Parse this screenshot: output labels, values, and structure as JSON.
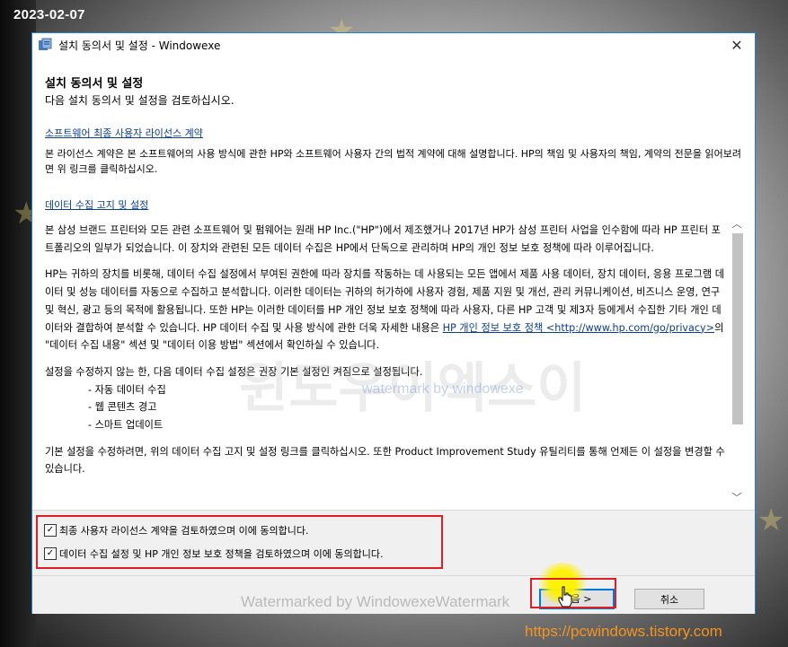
{
  "datestamp": "2023-02-07",
  "window": {
    "title": "설치 동의서 및 설정   - Windowexe",
    "close_glyph": "✕"
  },
  "content": {
    "heading": "설치 동의서 및 설정",
    "subheading": "다음 설치 동의서 및 설정을 검토하십시오.",
    "eula_link": "소프트웨어 최종 사용자 라이선스 계약",
    "eula_desc": "본 라이선스 계약은 본 소프트웨어의 사용 방식에 관한 HP와 소프트웨어 사용자 간의 법적 계약에 대해 설명합니다. HP의 책임 및 사용자의 책임, 계약의 전문을 읽어보려면 위 링크를 클릭하십시오.",
    "dc_link": "데이터 수집 고지 및 설정",
    "scroll_text": {
      "p1": "본 삼성 브랜드 프린터와 모든 관련 소프트웨어 및 펌웨어는 원래 HP Inc.(\"HP\")에서 제조했거나 2017년 HP가 삼성 프린터 사업을 인수함에 따라 HP 프린터 포트폴리오의 일부가 되었습니다. 이 장치와 관련된 모든 데이터 수집은 HP에서 단독으로 관리하며 HP의 개인 정보 보호 정책에 따라 이루어집니다.",
      "p2_before": "HP는 귀하의 장치를 비롯해, 데이터 수집 설정에서 부여된 권한에 따라 장치를 작동하는 데 사용되는 모든 앱에서 제품 사용 데이터, 장치 데이터, 응용 프로그램 데이터 및 성능 데이터를 자동으로 수집하고 분석합니다. 이러한 데이터는 귀하의 허가하에 사용자 경험, 제품 지원 및 개선, 관리 커뮤니케이션, 비즈니스 운영, 연구 및 혁신, 광고 등의 목적에 활용됩니다. 또한 HP는 이러한 데이터를 HP 개인 정보 보호 정책에 따라 사용자, 다른 HP 고객 및 제3자 등에게서 수집한 기타 개인 데이터와 결합하여 분석할 수 있습니다. HP 데이터 수집 및 사용 방식에 관한 더욱 자세한 내용은 ",
      "p2_link": "HP 개인 정보 보호 정책 <http://www.hp.com/go/privacy>",
      "p2_after": "의 \"데이터 수집 내용\" 섹션 및 \"데이터 이용 방법\" 섹션에서 확인하실 수 있습니다.",
      "p3": "설정을 수정하지 않는 한, 다음 데이터 수집 설정은 권장 기본 설정인 켜짐으로 설정됩니다.",
      "bullets": [
        "- 자동 데이터 수집",
        "- 웹 콘텐츠 경고",
        "- 스마트 업데이트"
      ],
      "p4": "기본 설정을 수정하려면, 위의 데이터 수집 고지 및 설정 링크를 클릭하십시오. 또한 Product Improvement Study 유틸리티를 통해 언제든 이 설정을 변경할 수 있습니다."
    }
  },
  "checkboxes": [
    {
      "label": "최종 사용자 라이선스 계약을 검토하였으며 이에 동의합니다.",
      "checked": true
    },
    {
      "label": "데이터 수집 설정 및 HP 개인 정보 보호 정책을 검토하였으며 이에 동의합니다.",
      "checked": true
    }
  ],
  "buttons": {
    "next": "다음 >",
    "cancel": "취소"
  },
  "watermarks": {
    "footer": "Watermarked by WindowexeWatermark",
    "center": "watermark by windowexe",
    "big": "윈도우이엑스이"
  },
  "site_url": "https://pcwindows.tistory.com",
  "colors": {
    "accent": "#0078d7",
    "link": "#0b3d91",
    "annotation_red": "#e01e25",
    "site_url": "#f7941d"
  }
}
